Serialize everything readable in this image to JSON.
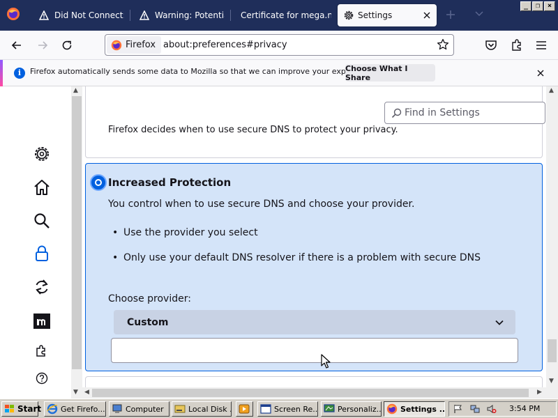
{
  "tabs": [
    {
      "title": "Did Not Connect: P",
      "icon": "warning-icon"
    },
    {
      "title": "Warning: Potentia",
      "icon": "warning-icon"
    },
    {
      "title": "Certificate for mega.nz",
      "icon": "none"
    },
    {
      "title": "Settings",
      "icon": "gear-icon",
      "active": true
    }
  ],
  "window_controls": {
    "minimize": "_",
    "restore": "❐",
    "close": "×"
  },
  "urlbar": {
    "identity_label": "Firefox",
    "url": "about:preferences#privacy"
  },
  "notification": {
    "text": "Firefox automatically sends some data to Mozilla so that we can improve your experience.",
    "button": "Choose What I Share"
  },
  "sidebar": {
    "items": [
      {
        "name": "General",
        "icon": "gear-icon"
      },
      {
        "name": "Home",
        "icon": "home-icon"
      },
      {
        "name": "Search",
        "icon": "search-icon"
      },
      {
        "name": "Privacy & Security",
        "icon": "lock-icon",
        "selected": true
      },
      {
        "name": "Sync",
        "icon": "sync-icon"
      },
      {
        "name": "More from Mozilla",
        "icon": "mozilla-icon"
      },
      {
        "name": "Extensions & Themes",
        "icon": "puzzle-icon"
      },
      {
        "name": "Firefox Support",
        "icon": "help-icon"
      }
    ]
  },
  "search": {
    "placeholder": "Find in Settings"
  },
  "dns": {
    "previous_option_desc": "Firefox decides when to use secure DNS to protect your privacy.",
    "selected_option": {
      "title": "Increased Protection",
      "desc": "You control when to use secure DNS and choose your provider.",
      "bullets": [
        "Use the provider you select",
        "Only use your default DNS resolver if there is a problem with secure DNS"
      ],
      "provider_label": "Choose provider:",
      "provider_value": "Custom",
      "custom_value": ""
    }
  },
  "taskbar": {
    "start": "Start",
    "tasks": [
      {
        "label": "Get Firefo...",
        "icon": "ie-icon"
      },
      {
        "label": "Computer",
        "icon": "computer-icon"
      },
      {
        "label": "Local Disk ...",
        "icon": "drive-icon"
      },
      {
        "label": "",
        "icon": "media-icon"
      },
      {
        "label": "Screen Re...",
        "icon": "window-icon"
      },
      {
        "label": "Personaliz...",
        "icon": "display-icon"
      },
      {
        "label": "Settings ...",
        "icon": "firefox-icon",
        "active": true
      }
    ],
    "clock": "3:54 PM"
  },
  "colors": {
    "accent": "#0060df",
    "tabbar": "#1f2e5a",
    "selected_card": "#d4e4f9"
  }
}
